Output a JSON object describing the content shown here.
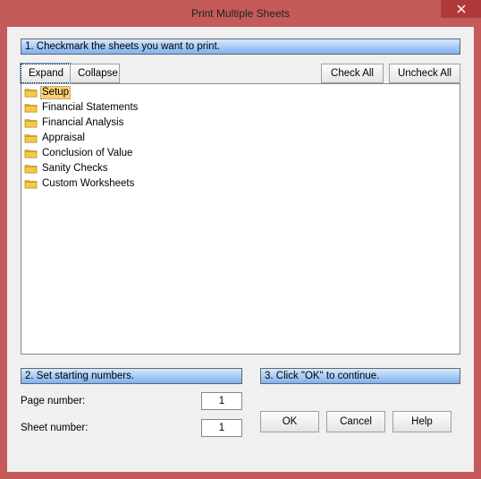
{
  "window": {
    "title": "Print Multiple Sheets"
  },
  "sections": {
    "s1": "1.  Checkmark the sheets you want to print.",
    "s2": "2.  Set starting numbers.",
    "s3": "3.  Click \"OK\" to continue."
  },
  "buttons": {
    "expand": "Expand",
    "collapse": "Collapse",
    "check_all": "Check All",
    "uncheck_all": "Uncheck All",
    "ok": "OK",
    "cancel": "Cancel",
    "help": "Help"
  },
  "tree": {
    "items": [
      {
        "label": "Setup",
        "selected": true
      },
      {
        "label": "Financial Statements",
        "selected": false
      },
      {
        "label": "Financial Analysis",
        "selected": false
      },
      {
        "label": "Appraisal",
        "selected": false
      },
      {
        "label": "Conclusion of Value",
        "selected": false
      },
      {
        "label": "Sanity Checks",
        "selected": false
      },
      {
        "label": "Custom Worksheets",
        "selected": false
      }
    ]
  },
  "numbers": {
    "page_label": "Page number:",
    "page_value": "1",
    "sheet_label": "Sheet number:",
    "sheet_value": "1"
  },
  "colors": {
    "frame": "#c45a5a",
    "header_grad_top": "#d6e8ff",
    "header_grad_bot": "#7db1f0",
    "selection": "#ffcf70"
  }
}
